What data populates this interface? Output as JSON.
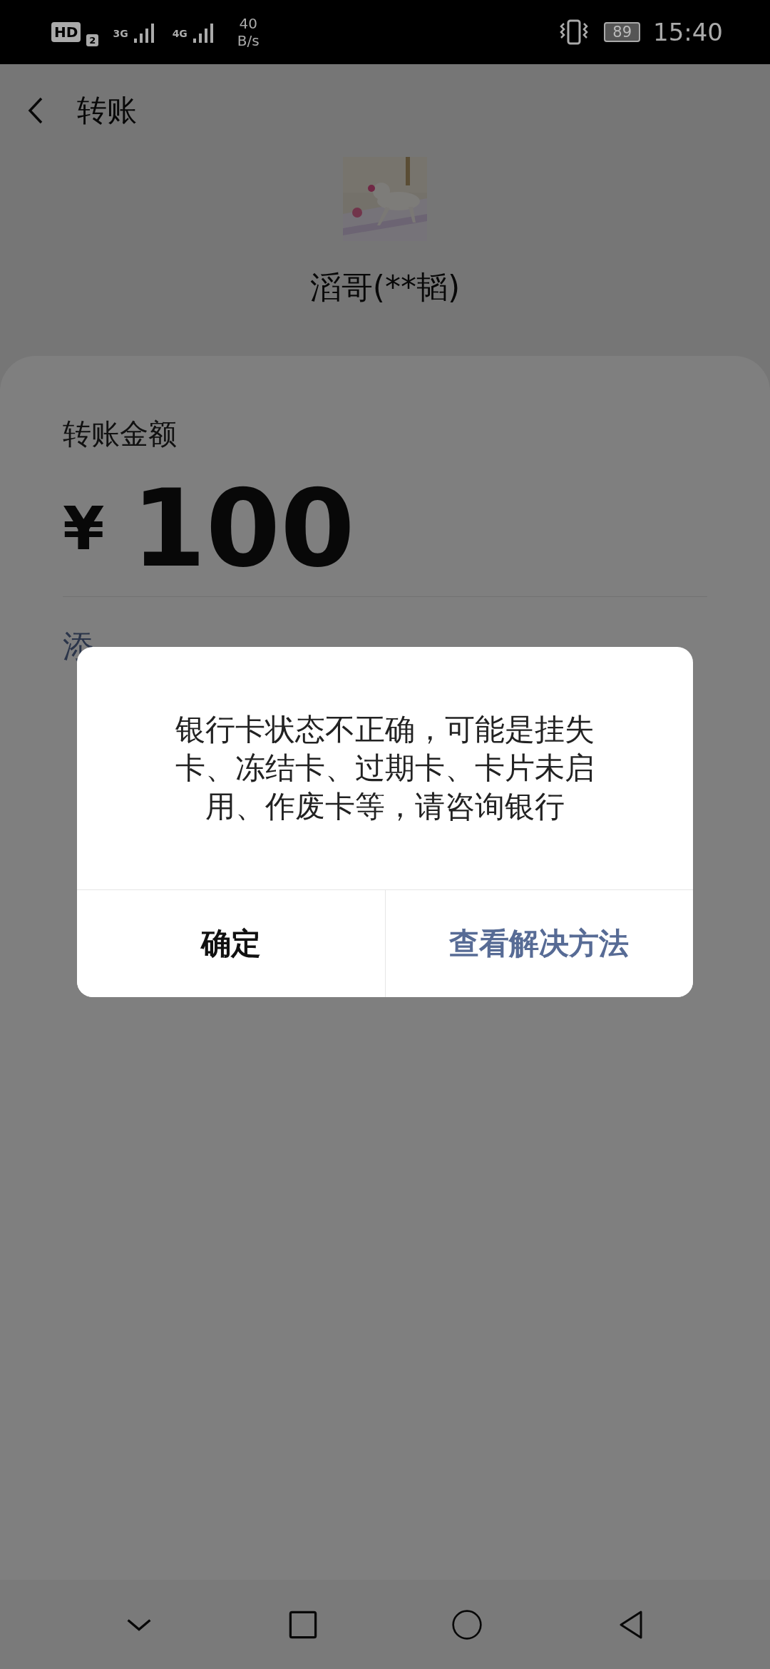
{
  "status_bar": {
    "hd": "HD",
    "sim": "2",
    "network_1": "3G",
    "network_2": "4G",
    "net_speed": "40",
    "net_speed_unit": "B/s",
    "battery": "89",
    "time": "15:40"
  },
  "header": {
    "title": "转账"
  },
  "payee": {
    "name": "滔哥(**韬)"
  },
  "amount": {
    "label": "转账金额",
    "currency": "¥",
    "value": "100"
  },
  "note_link": "添",
  "dialog": {
    "message": "银行卡状态不正确，可能是挂失卡、冻结卡、过期卡、卡片未启用、作废卡等，请咨询银行",
    "buttons": [
      {
        "label": "确定",
        "kind": "confirm"
      },
      {
        "label": "查看解决方法",
        "kind": "link"
      }
    ]
  }
}
